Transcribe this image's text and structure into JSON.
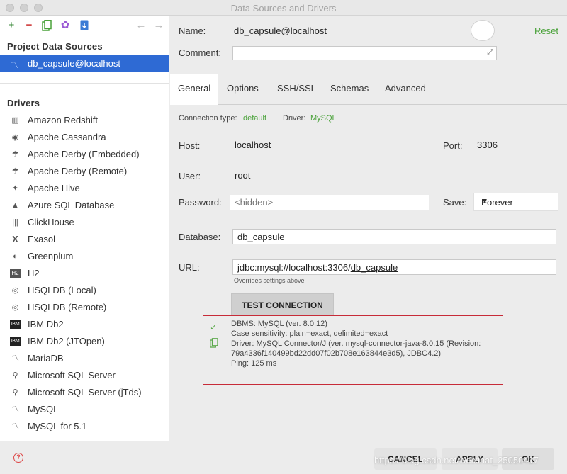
{
  "window": {
    "title": "Data Sources and Drivers"
  },
  "sidebar": {
    "toolbar_icons": [
      "add-icon",
      "remove-icon",
      "duplicate-icon",
      "settings-icon",
      "import-icon",
      "back-icon",
      "forward-icon"
    ],
    "project_title": "Project Data Sources",
    "selected_source": "db_capsule@localhost",
    "drivers_title": "Drivers",
    "drivers": [
      "Amazon Redshift",
      "Apache Cassandra",
      "Apache Derby (Embedded)",
      "Apache Derby (Remote)",
      "Apache Hive",
      "Azure SQL Database",
      "ClickHouse",
      "Exasol",
      "Greenplum",
      "H2",
      "HSQLDB (Local)",
      "HSQLDB (Remote)",
      "IBM Db2",
      "IBM Db2 (JTOpen)",
      "MariaDB",
      "Microsoft SQL Server",
      "Microsoft SQL Server (jTds)",
      "MySQL",
      "MySQL for 5.1"
    ]
  },
  "form": {
    "name_label": "Name:",
    "name_value": "db_capsule@localhost",
    "reset_label": "Reset",
    "comment_label": "Comment:",
    "comment_value": "",
    "tabs": [
      "General",
      "Options",
      "SSH/SSL",
      "Schemas",
      "Advanced"
    ],
    "active_tab": "General",
    "conn_type_label": "Connection type:",
    "conn_type_value": "default",
    "driver_label": "Driver:",
    "driver_value": "MySQL",
    "host_label": "Host:",
    "host_value": "localhost",
    "port_label": "Port:",
    "port_value": "3306",
    "user_label": "User:",
    "user_value": "root",
    "password_label": "Password:",
    "password_value": "<hidden>",
    "save_label": "Save:",
    "save_value": "Forever",
    "database_label": "Database:",
    "database_value": "db_capsule",
    "url_label": "URL:",
    "url_prefix": "jdbc:mysql://localhost:3306/",
    "url_db": "db_capsule",
    "url_hint": "Overrides settings above",
    "test_button": "TEST CONNECTION"
  },
  "result": {
    "lines": [
      "DBMS: MySQL (ver. 8.0.12)",
      "Case sensitivity: plain=exact, delimited=exact",
      "Driver: MySQL Connector/J (ver. mysql-connector-java-8.0.15 (Revision:",
      "79a4336f140499bd22dd07f02b708e163844e3d5), JDBC4.2)",
      "Ping: 125 ms"
    ]
  },
  "footer": {
    "cancel": "CANCEL",
    "apply": "APPLY",
    "ok": "OK",
    "watermark": "https://blog.csdn.net/weixinat_25050417"
  },
  "colors": {
    "accent": "#2e6ad4",
    "green": "#4aa23a",
    "error_border": "#c72b38"
  }
}
